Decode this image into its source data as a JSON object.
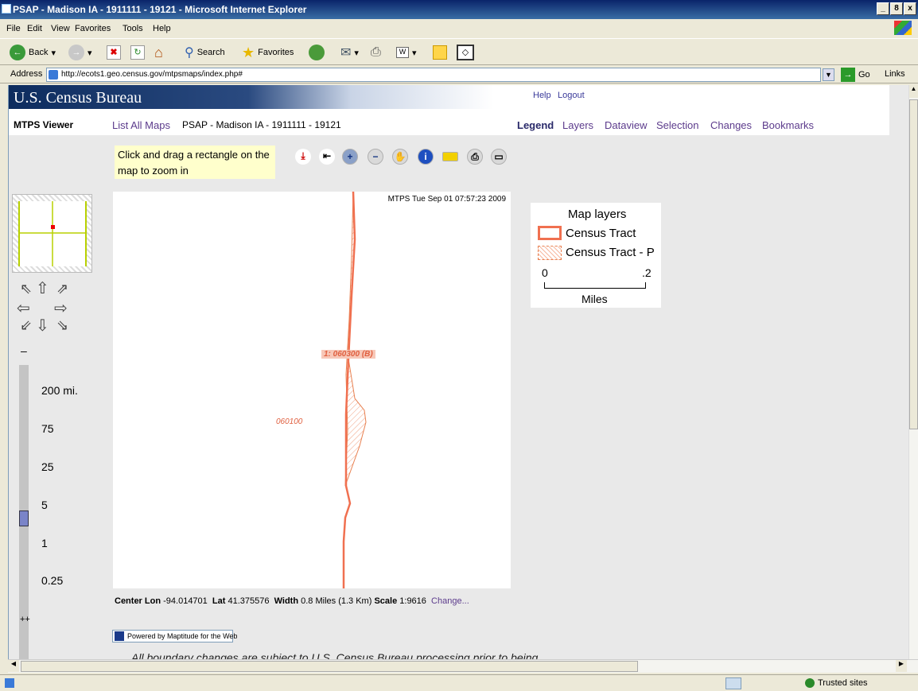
{
  "window": {
    "title": "PSAP - Madison IA - 1911111 - 19121 - Microsoft Internet Explorer",
    "min": "_",
    "max": "8",
    "close": "x"
  },
  "menu": [
    "File",
    "Edit",
    "View",
    "Favorites",
    "Tools",
    "Help"
  ],
  "toolbar": {
    "back": "Back",
    "search": "Search",
    "favorites": "Favorites"
  },
  "address": {
    "label": "Address",
    "url": "http://ecots1.geo.census.gov/mtpsmaps/index.php#",
    "go": "Go",
    "links": "Links"
  },
  "banner": {
    "title": "U.S. Census Bureau",
    "help": "Help",
    "logout": "Logout"
  },
  "nav": {
    "viewer": "MTPS Viewer",
    "list_maps": "List All Maps",
    "map_title": "PSAP - Madison IA - 1911111 - 19121",
    "tabs": [
      "Legend",
      "Layers",
      "Dataview",
      "Selection",
      "Changes",
      "Bookmarks"
    ]
  },
  "hint": "Click and drag a rectangle on the map to zoom in",
  "map": {
    "header": "MTPS Tue Sep 01 07:57:23 2009",
    "label_selected": "1: 060300 (B)",
    "label_other": "060100"
  },
  "legend": {
    "title": "Map layers",
    "items": [
      "Census Tract",
      "Census Tract - P"
    ],
    "scale_left": "0",
    "scale_right": ".2",
    "scale_unit": "Miles"
  },
  "zoom": {
    "minus": "–",
    "plus": "++",
    "labels": [
      "200 mi.",
      "75",
      "25",
      "5",
      "1",
      "0.25"
    ],
    "level_fraction": 0.49
  },
  "info": {
    "center_lon_label": "Center Lon",
    "center_lon": "-94.014701",
    "lat_label": "Lat",
    "lat": "41.375576",
    "width_label": "Width",
    "width": "0.8",
    "width_unit": "Miles (1.3 Km)",
    "scale_label": "Scale",
    "scale": "1:9616",
    "change": "Change..."
  },
  "powered": "Powered by Maptitude for the Web",
  "disclaimer": "All boundary changes are subject to U.S. Census Bureau processing prior to being",
  "status": {
    "zone": "Trusted sites"
  },
  "colors": {
    "tract": "#f07050",
    "accent": "#5c3b8c"
  }
}
